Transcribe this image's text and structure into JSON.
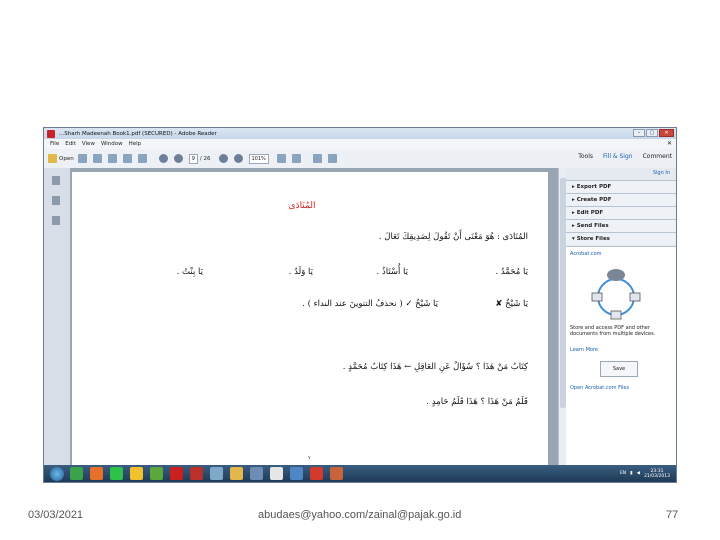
{
  "window": {
    "title": "...Sharh Madeenah Book1.pdf (SECURED) - Adobe Reader"
  },
  "menu": [
    "File",
    "Edit",
    "View",
    "Window",
    "Help"
  ],
  "toolbar": {
    "open_label": "Open",
    "page_current": "9",
    "page_total": "/ 26",
    "zoom": "101%",
    "tools_label": "Tools",
    "fill_sign_label": "Fill & Sign",
    "comment_label": "Comment"
  },
  "document": {
    "heading": "المُنَادَى",
    "line1": "المُنَادَى : هُوَ مَعْنَى أَنْ تَقُولَ لِصَدِيقِكَ تَعَالَ .",
    "row2": [
      "يَا مُحَمَّدُ .",
      "يَا أُسْتَاذُ .",
      "يَا وَلَدُ .",
      "يَا بِنْتُ ."
    ],
    "line3_wrong": "يَا شَيْخٌ ✘",
    "line3_right": "يَا شَيْخُ ✓ ( نحذفُ التنوينَ عند النداء ) .",
    "line5": "كِتَابُ مَنْ هَذَا ؟ سُؤَالٌ عَنِ العَاقِلِ ← هَذَا كِتَابُ مُحَمَّدٍ .",
    "line6": "قَلَمُ مَنْ هَذَا ؟ هَذَا قَلَمُ حَامِدٍ .",
    "page_marker": "٧"
  },
  "right_pane": {
    "sign_in": "Sign In",
    "items": [
      "Export PDF",
      "Create PDF",
      "Edit PDF",
      "Send Files",
      "Store Files"
    ],
    "acrobat_link": "Acrobat.com",
    "description": "Store and access PDF and other documents from multiple devices.",
    "learn_more": "Learn More",
    "save_button": "Save",
    "open_link": "Open Acrobat.com Files"
  },
  "taskbar": {
    "lang": "EN",
    "time": "23:31",
    "date": "21/03/2013"
  },
  "footer": {
    "date": "03/03/2021",
    "email": "abudaes@yahoo.com/zainal@pajak.go.id",
    "slide_number": "77"
  },
  "colors": {
    "heading_red": "#d02020",
    "link_blue": "#1b5fae",
    "taskbar": "#1e3a56"
  }
}
